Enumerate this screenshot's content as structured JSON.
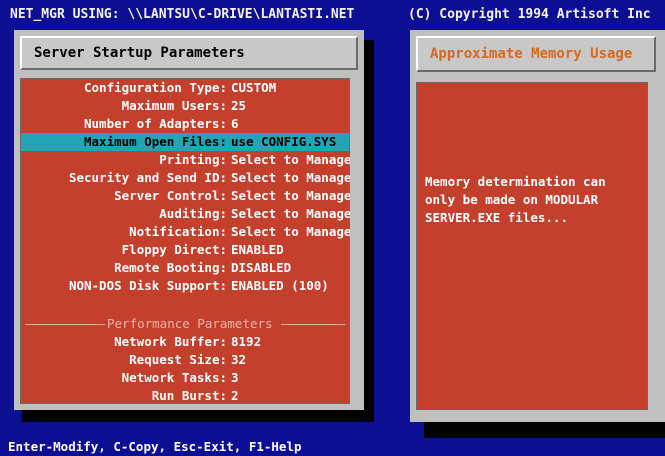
{
  "titlebar": {
    "left": "NET_MGR USING: \\\\LANTSU\\C-DRIVE\\LANTASTI.NET",
    "right": "(C) Copyright 1994 Artisoft Inc"
  },
  "server_window": {
    "title": "Server Startup Parameters",
    "fields": [
      {
        "label": "Configuration Type:",
        "value": "CUSTOM"
      },
      {
        "label": "Maximum Users:",
        "value": "25"
      },
      {
        "label": "Number of Adapters:",
        "value": "6"
      },
      {
        "label": "Maximum Open Files:",
        "value": "use CONFIG.SYS"
      },
      {
        "label": "Printing:",
        "value": "Select to Manage"
      },
      {
        "label": "Security and Send ID:",
        "value": "Select to Manage"
      },
      {
        "label": "Server Control:",
        "value": "Select to Manage"
      },
      {
        "label": "Auditing:",
        "value": "Select to Manage"
      },
      {
        "label": "Notification:",
        "value": "Select to Manage"
      },
      {
        "label": "Floppy Direct:",
        "value": "ENABLED"
      },
      {
        "label": "Remote Booting:",
        "value": "DISABLED"
      },
      {
        "label": "NON-DOS Disk Support:",
        "value": "ENABLED (100)"
      }
    ],
    "performance_header": "Performance Parameters",
    "performance_fields": [
      {
        "label": "Network Buffer:",
        "value": "8192"
      },
      {
        "label": "Request Size:",
        "value": "32"
      },
      {
        "label": "Network Tasks:",
        "value": "3"
      },
      {
        "label": "Run Burst:",
        "value": "2"
      }
    ]
  },
  "memory_window": {
    "title": "Approximate Memory Usage",
    "message_lines": [
      "Memory determination can",
      "only be made on MODULAR",
      "SERVER.EXE files..."
    ]
  },
  "statusbar": {
    "text": "Enter-Modify, C-Copy, Esc-Exit, F1-Help"
  },
  "colors": {
    "desktop": "#0c0f93",
    "panel_body": "#c5402c",
    "highlight": "#22a6b5",
    "frame": "#c0c0c0",
    "memory_title": "#d6681f"
  }
}
